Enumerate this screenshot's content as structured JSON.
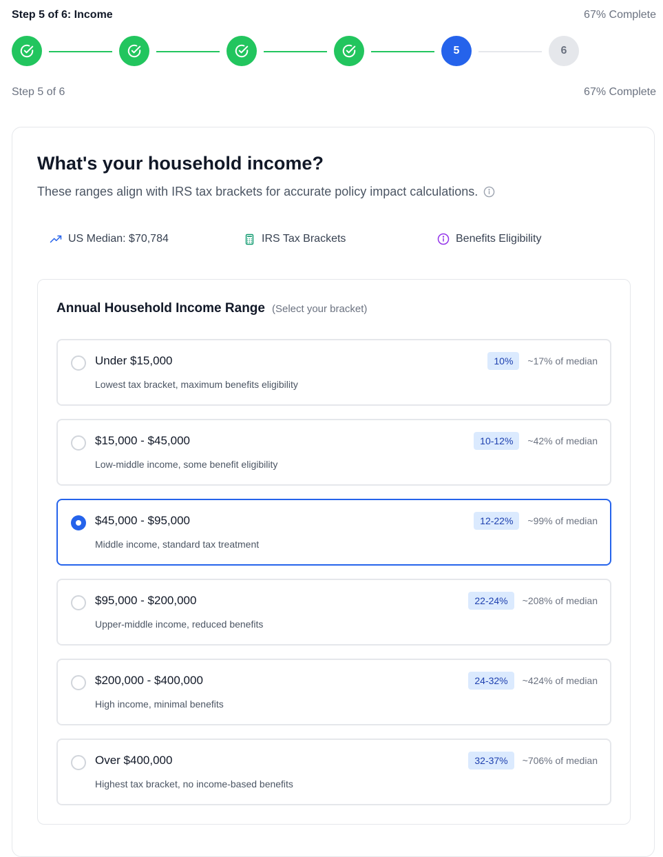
{
  "header": {
    "title": "Step 5 of 6: Income",
    "progress_text": "67% Complete"
  },
  "stepper": {
    "steps": [
      {
        "label": "",
        "state": "done"
      },
      {
        "label": "",
        "state": "done"
      },
      {
        "label": "",
        "state": "done"
      },
      {
        "label": "",
        "state": "done"
      },
      {
        "label": "5",
        "state": "active"
      },
      {
        "label": "6",
        "state": "pending"
      }
    ]
  },
  "subheader": {
    "step_text": "Step 5 of 6",
    "progress_text": "67% Complete"
  },
  "question": {
    "title": "What's your household income?",
    "subtitle": "These ranges align with IRS tax brackets for accurate policy impact calculations."
  },
  "info": {
    "median": "US Median: $70,784",
    "brackets": "IRS Tax Brackets",
    "benefits": "Benefits Eligibility"
  },
  "range": {
    "title": "Annual Household Income Range",
    "hint": "(Select your bracket)",
    "options": [
      {
        "label": "Under $15,000",
        "desc": "Lowest tax bracket, maximum benefits eligibility",
        "bracket": "10%",
        "median": "~17% of median",
        "selected": false
      },
      {
        "label": "$15,000 - $45,000",
        "desc": "Low-middle income, some benefit eligibility",
        "bracket": "10-12%",
        "median": "~42% of median",
        "selected": false
      },
      {
        "label": "$45,000 - $95,000",
        "desc": "Middle income, standard tax treatment",
        "bracket": "12-22%",
        "median": "~99% of median",
        "selected": true
      },
      {
        "label": "$95,000 - $200,000",
        "desc": "Upper-middle income, reduced benefits",
        "bracket": "22-24%",
        "median": "~208% of median",
        "selected": false
      },
      {
        "label": "$200,000 - $400,000",
        "desc": "High income, minimal benefits",
        "bracket": "24-32%",
        "median": "~424% of median",
        "selected": false
      },
      {
        "label": "Over $400,000",
        "desc": "Highest tax bracket, no income-based benefits",
        "bracket": "32-37%",
        "median": "~706% of median",
        "selected": false
      }
    ]
  },
  "colors": {
    "done": "#22c55e",
    "active": "#2563eb",
    "pending": "#e5e7eb",
    "badge_bg": "#dbeafe"
  }
}
